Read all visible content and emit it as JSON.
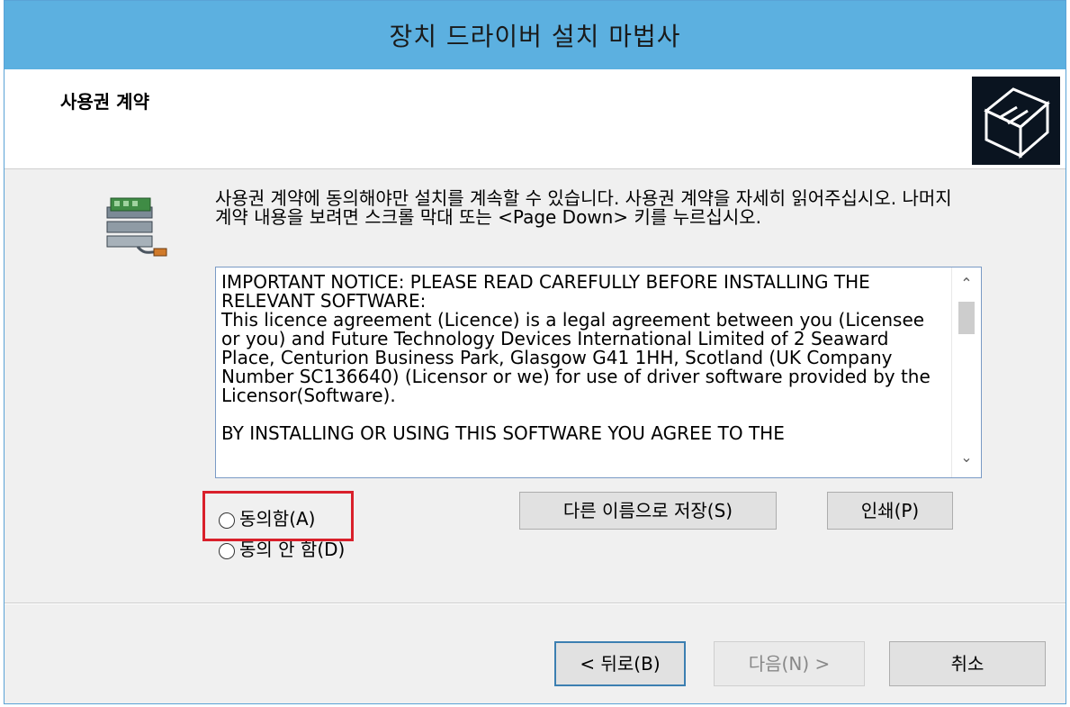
{
  "window": {
    "title": "장치 드라이버 설치 마법사"
  },
  "header": {
    "title": "사용권 계약",
    "icon": "driver-box-icon"
  },
  "instructions": "사용권 계약에 동의해야만 설치를 계속할 수 있습니다. 사용권 계약을 자세히 읽어주십시오. 나머지 계약 내용을 보려면 스크롤 막대 또는 <Page Down> 키를 누르십시오.",
  "license": {
    "text": "IMPORTANT NOTICE: PLEASE READ CAREFULLY BEFORE INSTALLING THE RELEVANT SOFTWARE:\nThis licence agreement (Licence) is a legal agreement between you (Licensee or you) and Future Technology Devices International Limited of 2 Seaward Place, Centurion Business Park, Glasgow G41 1HH, Scotland (UK Company Number SC136640) (Licensor or we) for use of driver software provided by the Licensor(Software).\n\nBY INSTALLING OR USING THIS SOFTWARE YOU AGREE TO THE"
  },
  "buttons": {
    "save_as": "다른 이름으로 저장(S)",
    "print": "인쇄(P)",
    "back": "< 뒤로(B)",
    "next": "다음(N) >",
    "cancel": "취소"
  },
  "radios": {
    "agree": "동의함(A)",
    "disagree": "동의 안 함(D)"
  },
  "colors": {
    "titlebar": "#5cb0e0",
    "highlight": "#d9202b"
  }
}
